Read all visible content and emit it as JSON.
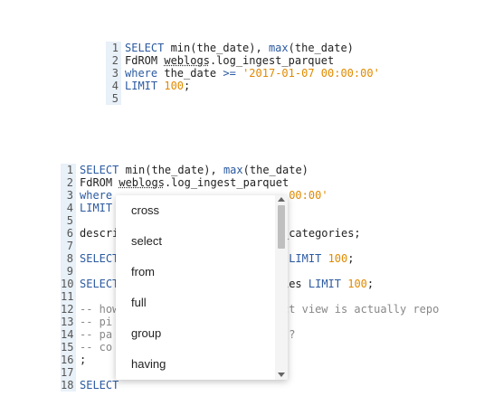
{
  "editor_top": {
    "lines": [
      {
        "n": "1",
        "tokens": [
          [
            "kw",
            "SELECT "
          ],
          [
            "",
            "min(the_date), "
          ],
          [
            "kw",
            "max"
          ],
          [
            "",
            "(the_date)"
          ]
        ]
      },
      {
        "n": "2",
        "tokens": [
          [
            "",
            "FdROM "
          ],
          [
            "squig",
            "weblogs"
          ],
          [
            "",
            ".log_ingest_parquet"
          ]
        ]
      },
      {
        "n": "3",
        "tokens": [
          [
            "kw",
            "where "
          ],
          [
            "",
            "the_date "
          ],
          [
            "op",
            ">= "
          ],
          [
            "str",
            "'2017-01-07 00:00:00'"
          ]
        ]
      },
      {
        "n": "4",
        "tokens": [
          [
            "kw",
            "LIMIT "
          ],
          [
            "num",
            "100"
          ],
          [
            "",
            ";"
          ]
        ]
      },
      {
        "n": "5",
        "tokens": []
      }
    ]
  },
  "editor_bottom": {
    "lines": [
      {
        "n": "1",
        "tokens": [
          [
            "kw",
            "SELECT "
          ],
          [
            "",
            "min(the_date), "
          ],
          [
            "kw",
            "max"
          ],
          [
            "",
            "(the_date)"
          ]
        ]
      },
      {
        "n": "2",
        "tokens": [
          [
            "",
            "FdROM "
          ],
          [
            "squig",
            "weblogs"
          ],
          [
            "",
            ".log_ingest_parquet"
          ]
        ]
      },
      {
        "n": "3",
        "tokens": [
          [
            "kw",
            "where "
          ],
          [
            "",
            "                          "
          ],
          [
            "str",
            "00:00'"
          ]
        ]
      },
      {
        "n": "4",
        "tokens": [
          [
            "kw",
            "LIMIT"
          ]
        ]
      },
      {
        "n": "5",
        "tokens": []
      },
      {
        "n": "6",
        "tokens": [
          [
            "",
            "descri                         _categories;"
          ]
        ]
      },
      {
        "n": "7",
        "tokens": []
      },
      {
        "n": "8",
        "tokens": [
          [
            "kw",
            "SELECT"
          ],
          [
            "",
            "                      ers "
          ],
          [
            "kw",
            "LIMIT "
          ],
          [
            "num",
            "100"
          ],
          [
            "",
            ";"
          ]
        ]
      },
      {
        "n": "9",
        "tokens": []
      },
      {
        "n": "10",
        "tokens": [
          [
            "kw",
            "SELECT"
          ],
          [
            "",
            "                      gories "
          ],
          [
            "kw",
            "LIMIT "
          ],
          [
            "num",
            "100"
          ],
          [
            "",
            ";"
          ]
        ]
      },
      {
        "n": "11",
        "tokens": []
      },
      {
        "n": "12",
        "tokens": [
          [
            "com",
            "-- how                       rect view is actually repo"
          ]
        ]
      },
      {
        "n": "13",
        "tokens": [
          [
            "com",
            "-- pi"
          ]
        ]
      },
      {
        "n": "14",
        "tokens": [
          [
            "com",
            "-- pa                        ist?"
          ]
        ]
      },
      {
        "n": "15",
        "tokens": [
          [
            "com",
            "-- co"
          ]
        ]
      },
      {
        "n": "16",
        "tokens": [
          [
            "",
            ";"
          ]
        ]
      },
      {
        "n": "17",
        "tokens": []
      },
      {
        "n": "18",
        "tokens": [
          [
            "kw",
            "SELECT"
          ]
        ]
      }
    ]
  },
  "autocomplete": {
    "items": [
      "cross",
      "select",
      "from",
      "full",
      "group",
      "having"
    ]
  }
}
